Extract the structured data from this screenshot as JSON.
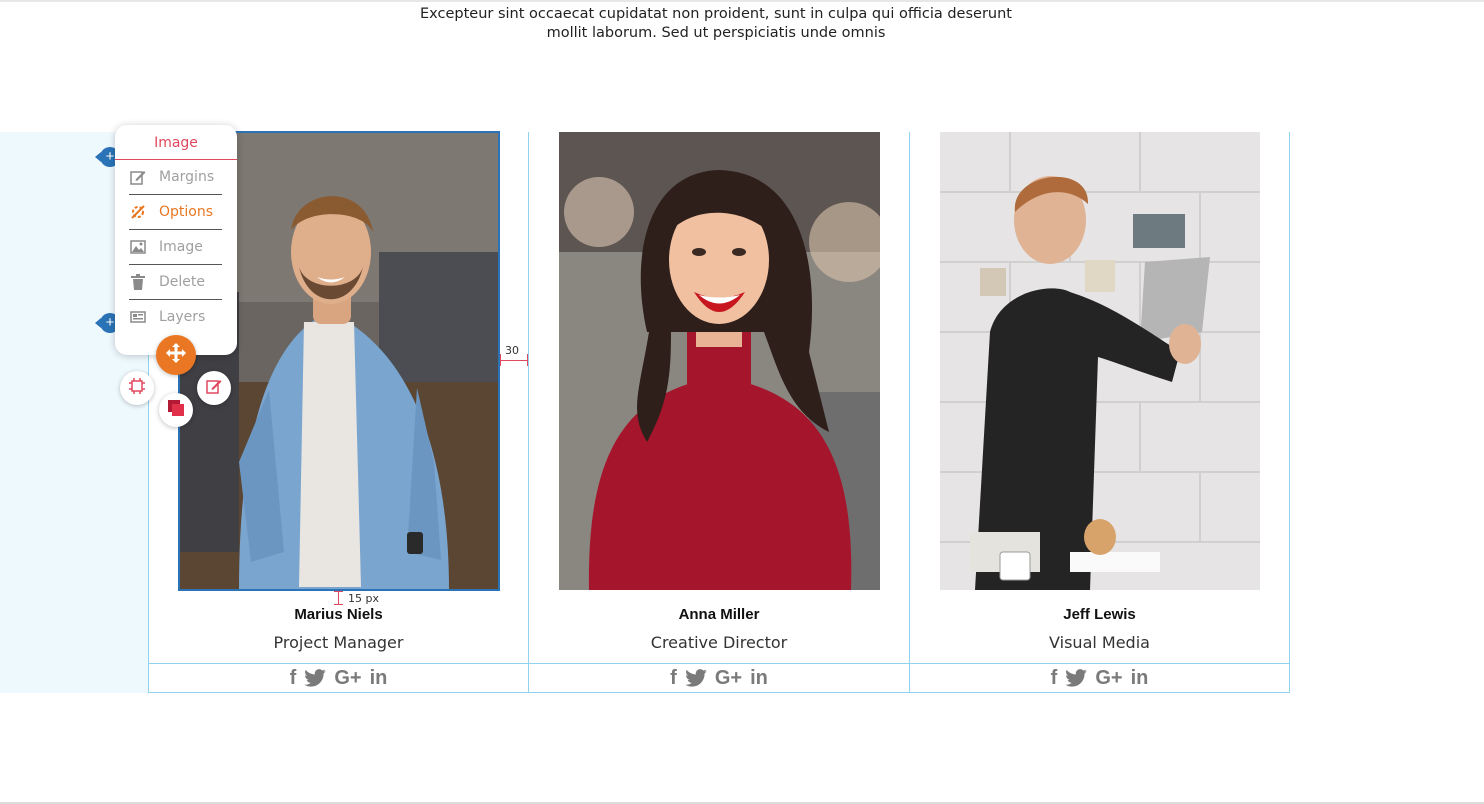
{
  "intro": {
    "line1": "Excepteur sint occaecat cupidatat non proident, sunt in culpa qui officia deserunt",
    "line2": "mollit laborum. Sed ut perspiciatis unde omnis"
  },
  "team": [
    {
      "name": "Marius Niels",
      "role": "Project Manager",
      "social_icons": [
        "facebook-icon",
        "twitter-icon",
        "google-plus-icon",
        "linkedin-icon"
      ]
    },
    {
      "name": "Anna Miller",
      "role": "Creative Director",
      "social_icons": [
        "facebook-icon",
        "twitter-icon",
        "google-plus-icon",
        "linkedin-icon"
      ]
    },
    {
      "name": "Jeff Lewis",
      "role": "Visual Media",
      "social_icons": [
        "facebook-icon",
        "twitter-icon",
        "google-plus-icon",
        "linkedin-icon"
      ]
    }
  ],
  "social_glyphs": {
    "facebook": "f",
    "google_plus": "G+",
    "linkedin": "in"
  },
  "editor": {
    "menu_title": "Image",
    "menu_items": [
      {
        "label": "Margins",
        "icon": "edit-icon"
      },
      {
        "label": "Options",
        "icon": "options-icon",
        "active": true
      },
      {
        "label": "Image",
        "icon": "image-icon"
      },
      {
        "label": "Delete",
        "icon": "trash-icon"
      },
      {
        "label": "Layers",
        "icon": "layers-icon"
      }
    ],
    "plus_label": "+",
    "margin_value": "30",
    "padding_value": "15",
    "padding_unit": "px"
  },
  "colors": {
    "accent_red": "#e0485e",
    "accent_orange": "#ea7723",
    "editor_blue": "#2a73b6",
    "guide_blue": "#8fd3f0",
    "band_bg": "#eef9fe"
  }
}
